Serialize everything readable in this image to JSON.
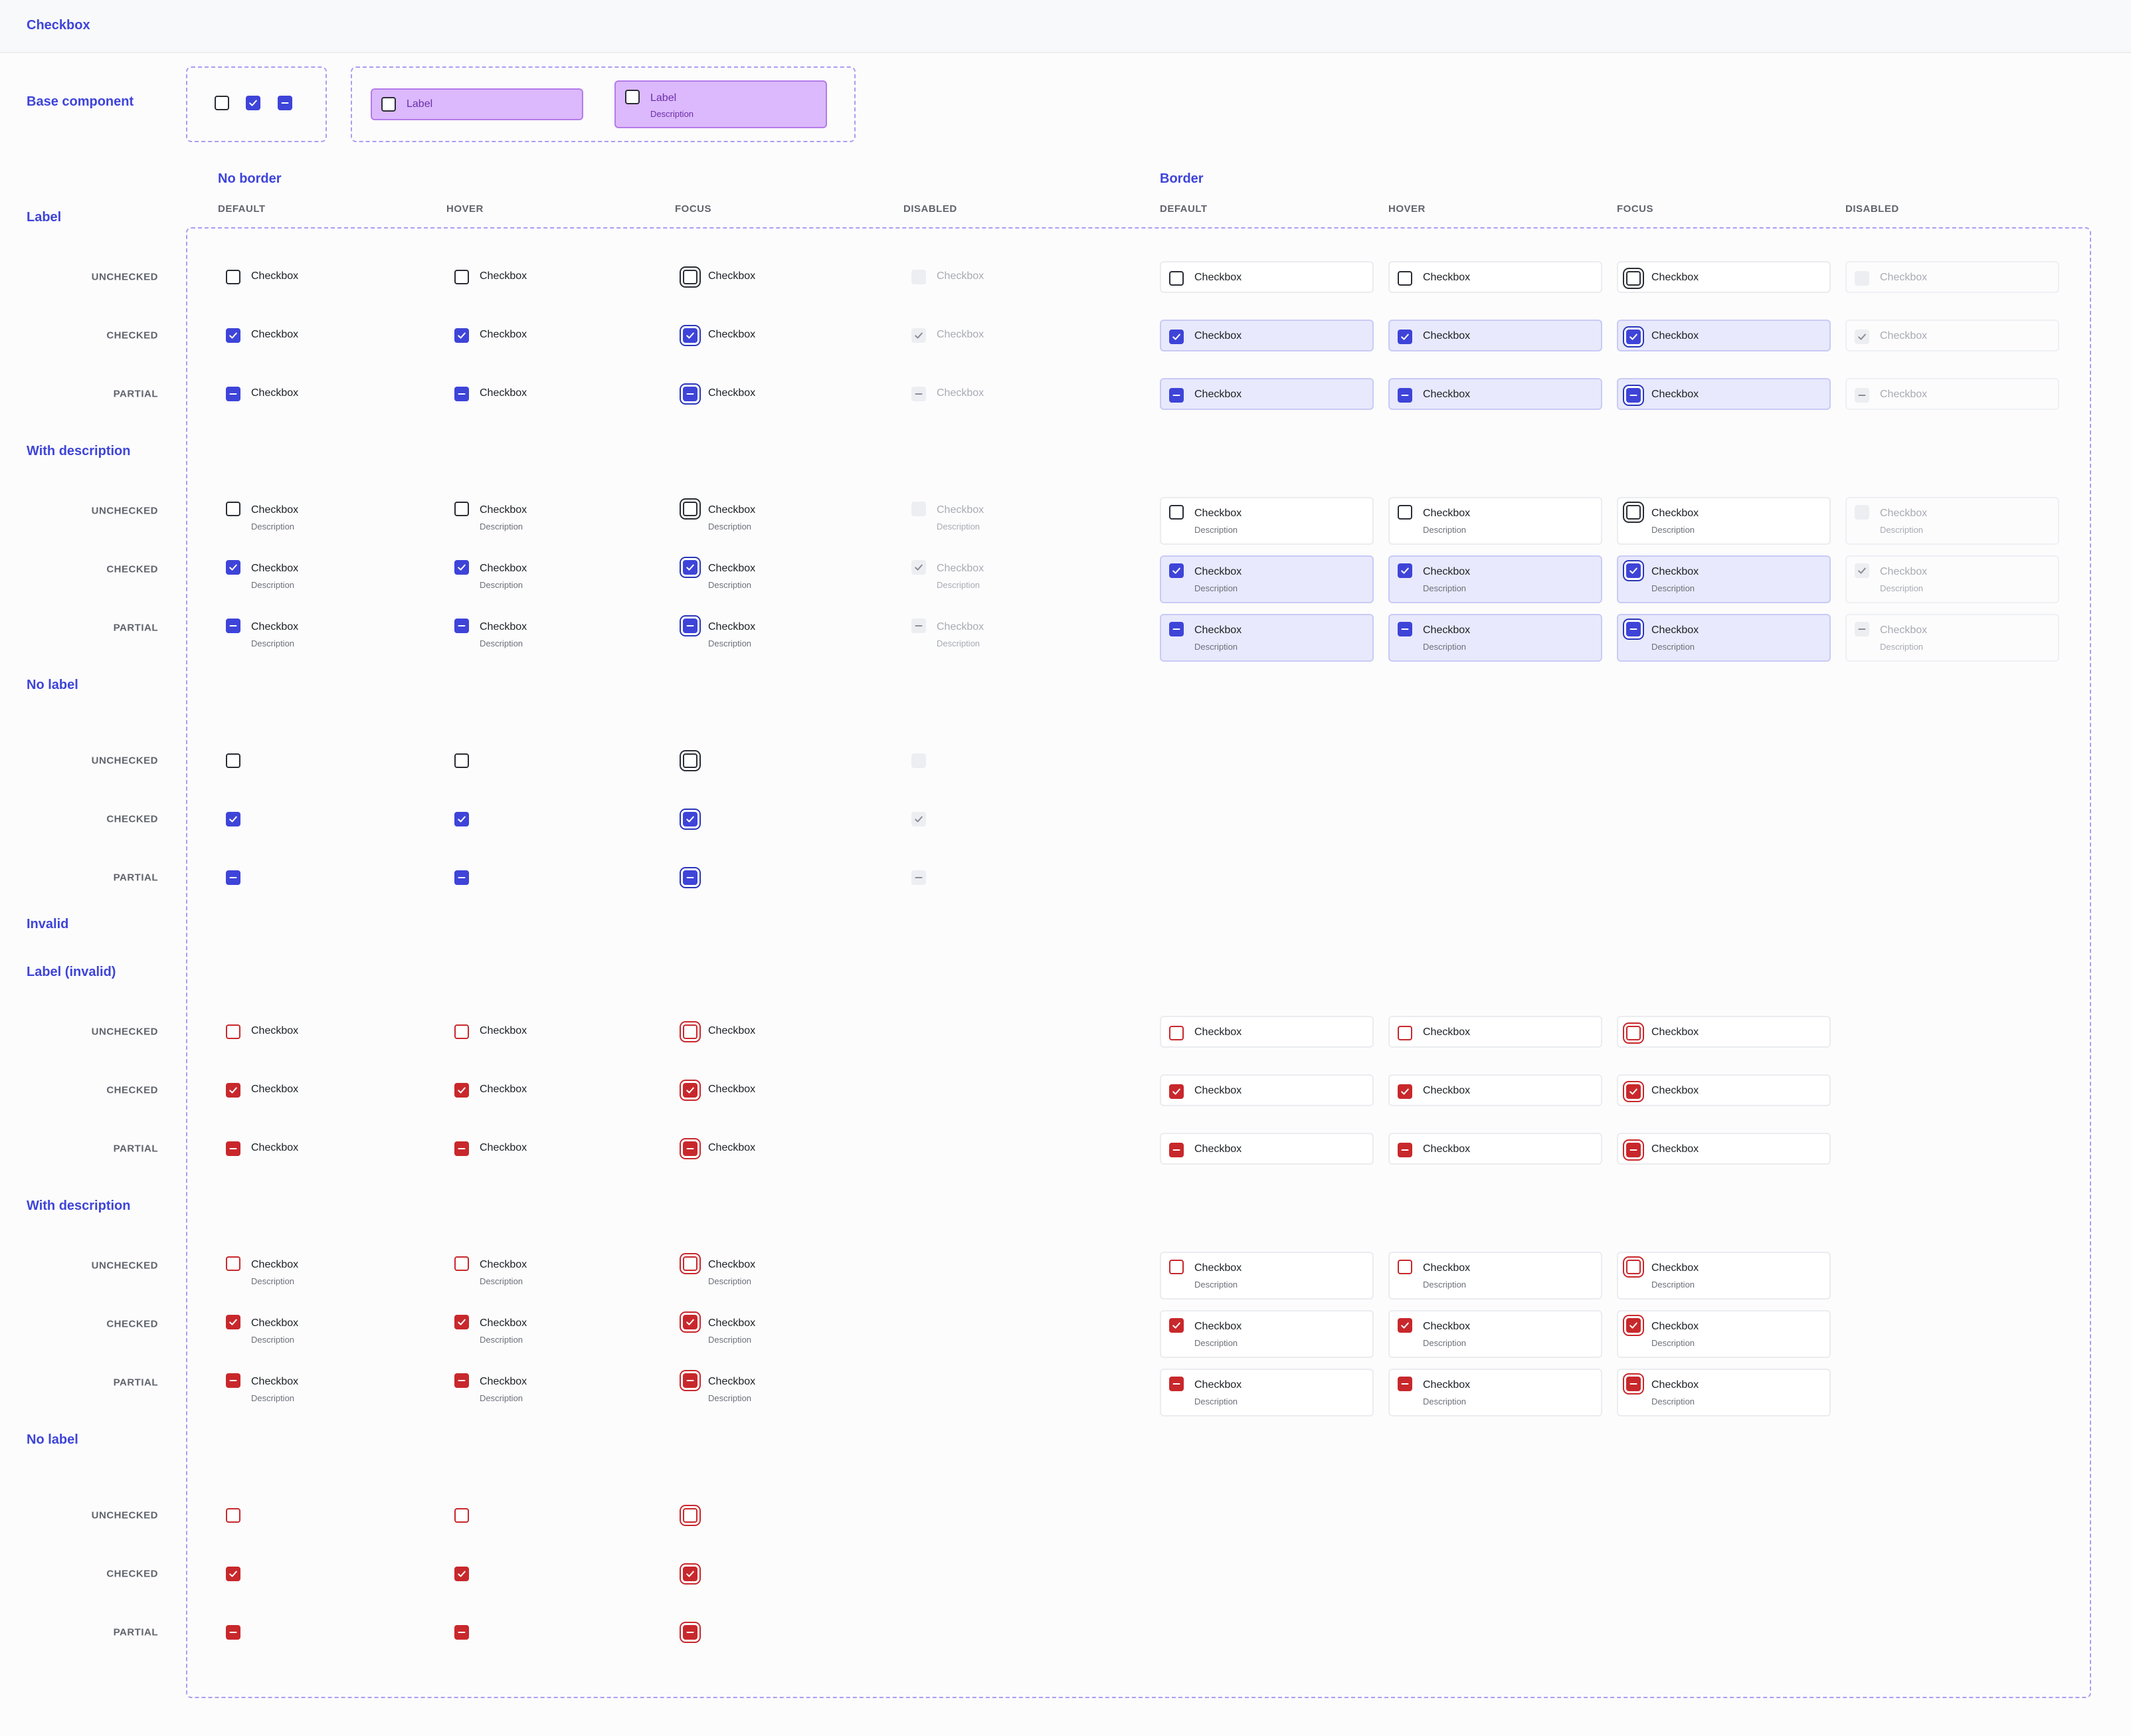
{
  "header": {
    "title": "Checkbox"
  },
  "sections": {
    "base": "Base component",
    "label": "Label",
    "with_description": "With description",
    "no_label": "No label",
    "invalid": "Invalid",
    "label_invalid": "Label (invalid)",
    "with_description_invalid": "With description",
    "no_label_invalid": "No label"
  },
  "groups": {
    "no_border": "No border",
    "border": "Border"
  },
  "columns": [
    "DEFAULT",
    "HOVER",
    "FOCUS",
    "DISABLED",
    "DEFAULT",
    "HOVER",
    "FOCUS",
    "DISABLED"
  ],
  "rows": [
    "UNCHECKED",
    "CHECKED",
    "PARTIAL"
  ],
  "item": {
    "label": "Checkbox",
    "description": "Description"
  },
  "base_component": {
    "label": "Label",
    "description": "Description"
  },
  "colors": {
    "accent": "#3e44d8",
    "invalid": "#c8282c",
    "base_card": "#dcb8fc",
    "selected_bg": "#e8e9fc"
  }
}
